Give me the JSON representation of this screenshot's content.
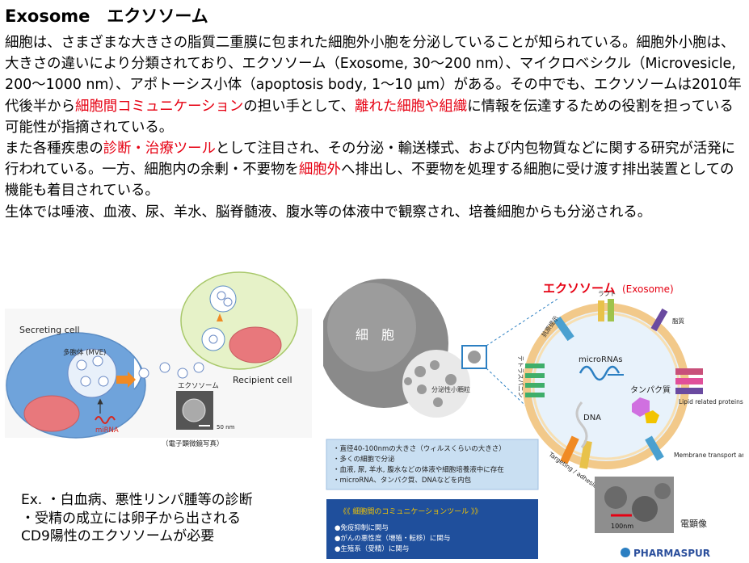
{
  "title": "Exosome　エクソソーム",
  "paragraphs": [
    [
      {
        "t": "細胞は、さまざまな大きさの脂質二重膜に包まれた細胞外小胞を分泌していることが知られている。細胞外小胞は、大きさの違いにより分類されており、エクソソーム（Exosome, 30〜200 nm）、マイクロベシクル（Microvesicle, 200〜1000 nm）、アポトーシス小体（apoptosis body, 1〜10 μm）がある。その中でも、エクソソームは2010年代後半から",
        "red": false
      },
      {
        "t": "細胞間コミュニケーション",
        "red": true
      },
      {
        "t": "の担い手として、",
        "red": false
      },
      {
        "t": "離れた細胞や組織",
        "red": true
      },
      {
        "t": "に情報を伝達するための役割を担っている可能性が指摘されている。",
        "red": false
      }
    ],
    [
      {
        "t": "また各種疾患の",
        "red": false
      },
      {
        "t": "診断・治療ツール",
        "red": true
      },
      {
        "t": "として注目され、その分泌・輸送様式、および内包物質などに関する研究が活発に行われている。一方、細胞内の余剰・不要物を",
        "red": false
      },
      {
        "t": "細胞外",
        "red": true
      },
      {
        "t": "へ排出し、不要物を処理する細胞に受け渡す排出装置としての機能も着目されている。",
        "red": false
      }
    ],
    [
      {
        "t": "生体では唾液、血液、尿、羊水、脳脊髄液、腹水等の体液中で観察され、培養細胞からも分泌される。",
        "red": false
      }
    ]
  ],
  "left_figure": {
    "secreting_cell": "Secreting cell",
    "mve": "多胞体 (MVE)",
    "mirna": "miRNA",
    "exosome": "エクソソーム",
    "scale": "50 nm",
    "micrograph_caption": "（電子顕微鏡写真）",
    "recipient_cell": "Recipient cell"
  },
  "right_figure": {
    "cell_label": "細　胞",
    "secretory_particles": "分泌性小顆粒",
    "exosome_title": "エクソソーム",
    "exosome_en": "(Exosome)",
    "raft": "ラフト",
    "lipid": "脂質",
    "antigen": "抗原提示",
    "tetraspanin": "テトラスパニン",
    "micrornas": "microRNAs",
    "protein": "タンパク質",
    "dna": "DNA",
    "lipid_proteins": "Lipid related proteins",
    "membrane_transport": "Membrane transport and fusion",
    "targeting": "Targeting / adhesion",
    "info_lines": [
      "・直径40-100nmの大きさ（ウィルスくらいの大きさ）",
      "・多くの細胞で分泌",
      "・血液, 尿, 羊水, 腹水などの体液や細胞培養液中に存在",
      "・microRNA、タンパク質、DNAなどを内包"
    ],
    "tool_title": "《《 細胞間のコミュニケーションツール 》》",
    "tool_lines": [
      "●免疫抑制に関与",
      "●がんの悪性度（増殖・転移）に関与",
      "●生殖系（受精）に関与"
    ],
    "em_scale": "100nm",
    "em_label": "電顕像",
    "brand": "PHARMASPUR"
  },
  "example_lines": [
    "Ex. ・白血病、悪性リンパ腫等の診断",
    "・受精の成立には卵子から出される",
    "CD9陽性のエクソソームが必要"
  ],
  "colors": {
    "accent_red": "#e60012",
    "cell_blue": "#6fa3db",
    "recipient_green": "#e6f2c8",
    "nucleus_pink": "#e8787c",
    "arrow_orange": "#f08a24",
    "exosome_red": "#d9271e",
    "info_box": "#c9dff2",
    "tool_box": "#1f4f9c"
  }
}
